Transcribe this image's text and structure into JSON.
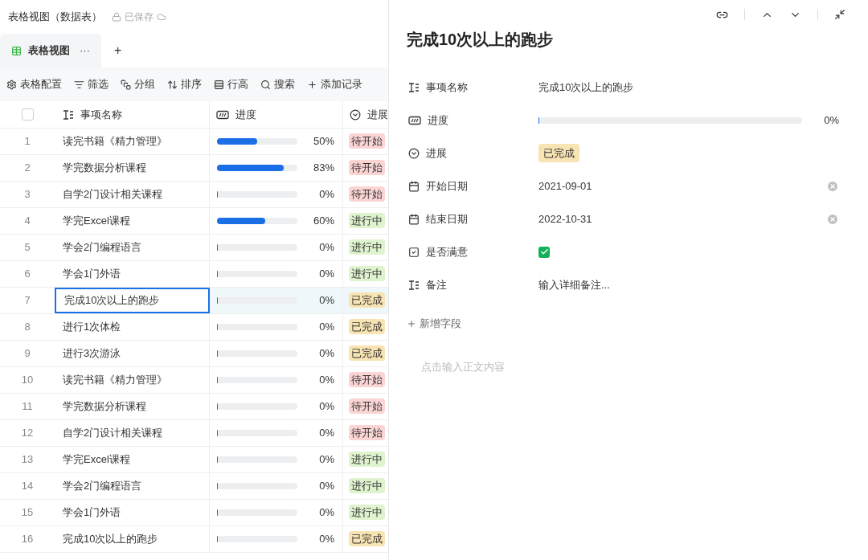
{
  "header": {
    "title": "表格视图（数据表）",
    "save_status": "已保存"
  },
  "view_tabs": [
    {
      "label": "表格视图",
      "more": "···",
      "selected": true
    }
  ],
  "add_view": "+",
  "toolbar": [
    {
      "kind": "settings",
      "label": "表格配置"
    },
    {
      "kind": "filter",
      "label": "筛选"
    },
    {
      "kind": "group",
      "label": "分组"
    },
    {
      "kind": "sort",
      "label": "排序"
    },
    {
      "kind": "height",
      "label": "行高"
    },
    {
      "kind": "search",
      "label": "搜索"
    },
    {
      "kind": "add",
      "label": "添加记录"
    }
  ],
  "table": {
    "select_all_checked": false,
    "columns": [
      {
        "kind": "text",
        "label": "事项名称"
      },
      {
        "kind": "progress",
        "label": "进度"
      },
      {
        "kind": "status",
        "label": "进展"
      }
    ],
    "rows": [
      {
        "number": "1",
        "name": "读完书籍《精力管理》",
        "level": 0.5,
        "reading": "50%",
        "status": "待开始",
        "color": "#fbd4d4",
        "selected": false
      },
      {
        "number": "2",
        "name": "学完数据分析课程",
        "level": 0.83,
        "reading": "83%",
        "status": "待开始",
        "color": "#fbd4d4",
        "selected": false
      },
      {
        "number": "3",
        "name": "自学2门设计相关课程",
        "level": 0,
        "reading": "0%",
        "status": "待开始",
        "color": "#fbd4d4",
        "selected": false
      },
      {
        "number": "4",
        "name": "学完Excel课程",
        "level": 0.6,
        "reading": "60%",
        "status": "进行中",
        "color": "#dff3cf",
        "selected": false
      },
      {
        "number": "5",
        "name": "学会2门编程语言",
        "level": 0,
        "reading": "0%",
        "status": "进行中",
        "color": "#dff3cf",
        "selected": false
      },
      {
        "number": "6",
        "name": "学会1门外语",
        "level": 0,
        "reading": "0%",
        "status": "进行中",
        "color": "#dff3cf",
        "selected": false
      },
      {
        "number": "7",
        "name": "完成10次以上的跑步",
        "level": 0,
        "reading": "0%",
        "status": "已完成",
        "color": "#f8e3b3",
        "selected": true
      },
      {
        "number": "8",
        "name": "进行1次体检",
        "level": 0,
        "reading": "0%",
        "status": "已完成",
        "color": "#f8e3b3",
        "selected": false
      },
      {
        "number": "9",
        "name": "进行3次游泳",
        "level": 0,
        "reading": "0%",
        "status": "已完成",
        "color": "#f8e3b3",
        "selected": false
      },
      {
        "number": "10",
        "name": "读完书籍《精力管理》",
        "level": 0,
        "reading": "0%",
        "status": "待开始",
        "color": "#fbd4d4",
        "selected": false
      },
      {
        "number": "11",
        "name": "学完数据分析课程",
        "level": 0,
        "reading": "0%",
        "status": "待开始",
        "color": "#fbd4d4",
        "selected": false
      },
      {
        "number": "12",
        "name": "自学2门设计相关课程",
        "level": 0,
        "reading": "0%",
        "status": "待开始",
        "color": "#fbd4d4",
        "selected": false
      },
      {
        "number": "13",
        "name": "学完Excel课程",
        "level": 0,
        "reading": "0%",
        "status": "进行中",
        "color": "#dff3cf",
        "selected": false
      },
      {
        "number": "14",
        "name": "学会2门编程语言",
        "level": 0,
        "reading": "0%",
        "status": "进行中",
        "color": "#dff3cf",
        "selected": false
      },
      {
        "number": "15",
        "name": "学会1门外语",
        "level": 0,
        "reading": "0%",
        "status": "进行中",
        "color": "#dff3cf",
        "selected": false
      },
      {
        "number": "16",
        "name": "完成10次以上的跑步",
        "level": 0,
        "reading": "0%",
        "status": "已完成",
        "color": "#f8e3b3",
        "selected": false
      }
    ]
  },
  "detail": {
    "title": "完成10次以上的跑步",
    "fields": [
      {
        "kind": "text",
        "label": "事项名称",
        "value": "完成10次以上的跑步"
      },
      {
        "kind": "progress",
        "label": "进度",
        "level": 0,
        "reading": "0%"
      },
      {
        "kind": "status",
        "label": "进展",
        "value": "已完成",
        "color": "#f8e3b3"
      },
      {
        "kind": "date",
        "label": "开始日期",
        "value": "2021-09-01"
      },
      {
        "kind": "date",
        "label": "结束日期",
        "value": "2022-10-31"
      },
      {
        "kind": "checkbox",
        "label": "是否满意",
        "checked": true
      },
      {
        "kind": "note",
        "label": "备注",
        "placeholder": "输入详细备注..."
      }
    ],
    "add_field": "新增字段",
    "body_placeholder": "点击输入正文内容"
  }
}
